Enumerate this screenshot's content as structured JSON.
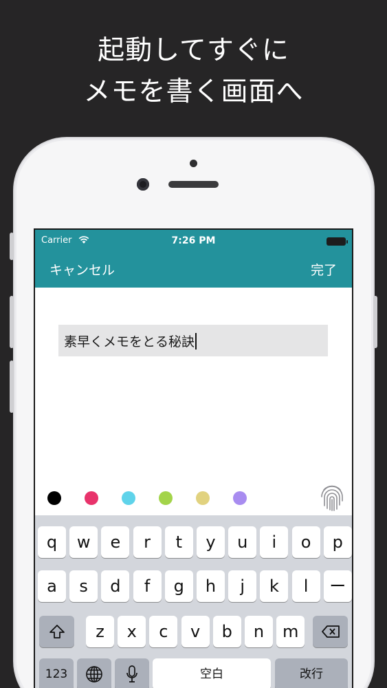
{
  "headline": {
    "line1": "起動してすぐに",
    "line2": "メモを書く画面へ"
  },
  "status_bar": {
    "carrier": "Carrier",
    "time": "7:26 PM"
  },
  "nav": {
    "cancel_label": "キャンセル",
    "done_label": "完了"
  },
  "memo": {
    "text": "素早くメモをとる秘訣"
  },
  "palette": {
    "colors": [
      "#000000",
      "#e8336b",
      "#5fd3ea",
      "#a3d44a",
      "#e1d27f",
      "#a88cf0"
    ],
    "fingerprint_icon": "fingerprint-icon"
  },
  "keyboard": {
    "row1": [
      "q",
      "w",
      "e",
      "r",
      "t",
      "y",
      "u",
      "i",
      "o",
      "p"
    ],
    "row2": [
      "a",
      "s",
      "d",
      "f",
      "g",
      "h",
      "j",
      "k",
      "l",
      "ー"
    ],
    "row3": [
      "z",
      "x",
      "c",
      "v",
      "b",
      "n",
      "m"
    ],
    "numbers_label": "123",
    "space_label": "空白",
    "return_label": "改行",
    "shift_icon": "shift-icon",
    "delete_icon": "backspace-icon",
    "globe_icon": "globe-icon",
    "mic_icon": "microphone-icon"
  }
}
